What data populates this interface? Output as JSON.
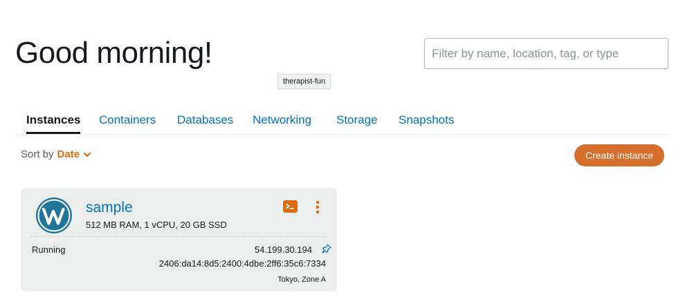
{
  "header": {
    "greeting": "Good morning!",
    "search_placeholder": "Filter by name, location, tag, or type",
    "tooltip": "therapist-fun"
  },
  "tabs": [
    {
      "label": "Instances",
      "active": true
    },
    {
      "label": "Containers",
      "active": false
    },
    {
      "label": "Databases",
      "active": false
    },
    {
      "label": "Networking",
      "active": false
    },
    {
      "label": "Storage",
      "active": false
    },
    {
      "label": "Snapshots",
      "active": false
    }
  ],
  "toolbar": {
    "sort_label": "Sort by",
    "sort_value": "Date",
    "create_label": "Create instance"
  },
  "instance": {
    "name": "sample",
    "specs": "512 MB RAM, 1 vCPU, 20 GB SSD",
    "status": "Running",
    "ipv4": "54.199.30.194",
    "ipv6": "2406:da14:8d5:2400:4dbe:2ff6:35c6:7334",
    "zone": "Tokyo, Zone A",
    "logo_icon": "wordpress-icon"
  },
  "colors": {
    "accent_orange": "#dd6b10",
    "link_blue": "#0073bb",
    "card_bg": "#eceded"
  }
}
